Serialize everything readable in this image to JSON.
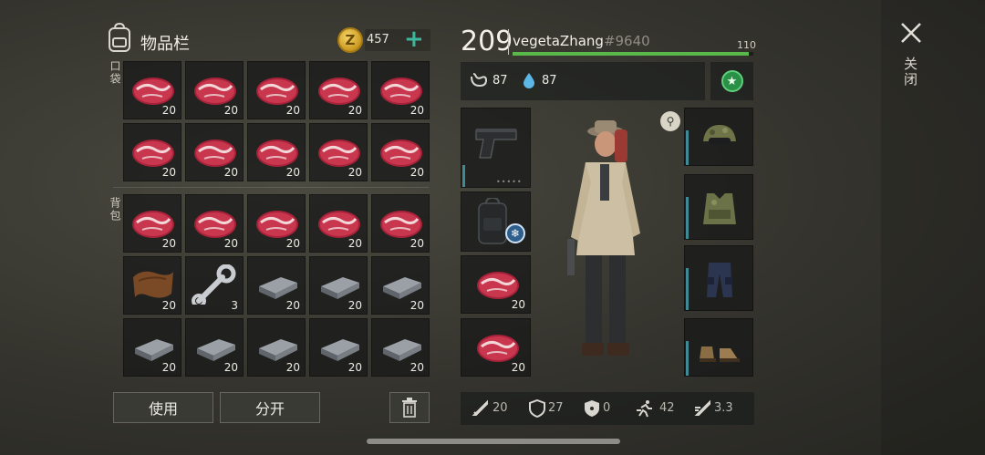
{
  "inventory": {
    "title": "物品栏",
    "section_pocket": "口袋",
    "section_backpack": "背包",
    "coins": "457",
    "coin_symbol": "Z",
    "add_label": "+"
  },
  "pocket_items": [
    {
      "icon": "raw-meat",
      "qty": "20"
    },
    {
      "icon": "raw-meat",
      "qty": "20"
    },
    {
      "icon": "raw-meat",
      "qty": "20"
    },
    {
      "icon": "raw-meat",
      "qty": "20"
    },
    {
      "icon": "raw-meat",
      "qty": "20"
    },
    {
      "icon": "raw-meat",
      "qty": "20"
    },
    {
      "icon": "raw-meat",
      "qty": "20"
    },
    {
      "icon": "raw-meat",
      "qty": "20"
    },
    {
      "icon": "raw-meat",
      "qty": "20"
    },
    {
      "icon": "raw-meat",
      "qty": "20"
    }
  ],
  "backpack_items": [
    {
      "icon": "raw-meat",
      "qty": "20"
    },
    {
      "icon": "raw-meat",
      "qty": "20"
    },
    {
      "icon": "raw-meat",
      "qty": "20"
    },
    {
      "icon": "raw-meat",
      "qty": "20"
    },
    {
      "icon": "raw-meat",
      "qty": "20"
    },
    {
      "icon": "leather",
      "qty": "20"
    },
    {
      "icon": "wrench",
      "qty": "3"
    },
    {
      "icon": "iron-bar",
      "qty": "20"
    },
    {
      "icon": "iron-bar",
      "qty": "20"
    },
    {
      "icon": "iron-bar",
      "qty": "20"
    },
    {
      "icon": "iron-bar",
      "qty": "20"
    },
    {
      "icon": "iron-bar",
      "qty": "20"
    },
    {
      "icon": "iron-bar",
      "qty": "20"
    },
    {
      "icon": "iron-bar",
      "qty": "20"
    },
    {
      "icon": "iron-bar",
      "qty": "20"
    }
  ],
  "actions": {
    "use": "使用",
    "split": "分开"
  },
  "player": {
    "level": "209",
    "name": "vegetaZhang",
    "tag": "#9640",
    "xp_max": "110",
    "xp_fraction": 0.98,
    "hunger": "87",
    "thirst": "87"
  },
  "quick_slots": [
    {
      "icon": "pistol",
      "qty": ""
    },
    {
      "icon": "backpack",
      "qty": ""
    },
    {
      "icon": "raw-meat",
      "qty": "20"
    },
    {
      "icon": "raw-meat",
      "qty": "20"
    }
  ],
  "gear_slots": [
    "camo-helmet",
    "camo-vest",
    "tactical-pants",
    "boots"
  ],
  "combat_stats": {
    "damage": "20",
    "defense": "27",
    "radiation": "0",
    "speed": "42",
    "attack_speed": "3.3"
  },
  "close_label": "关闭",
  "colors": {
    "xp_bar": "#58b84a",
    "accent": "#3fb59a",
    "durability": "#3f8a96"
  }
}
